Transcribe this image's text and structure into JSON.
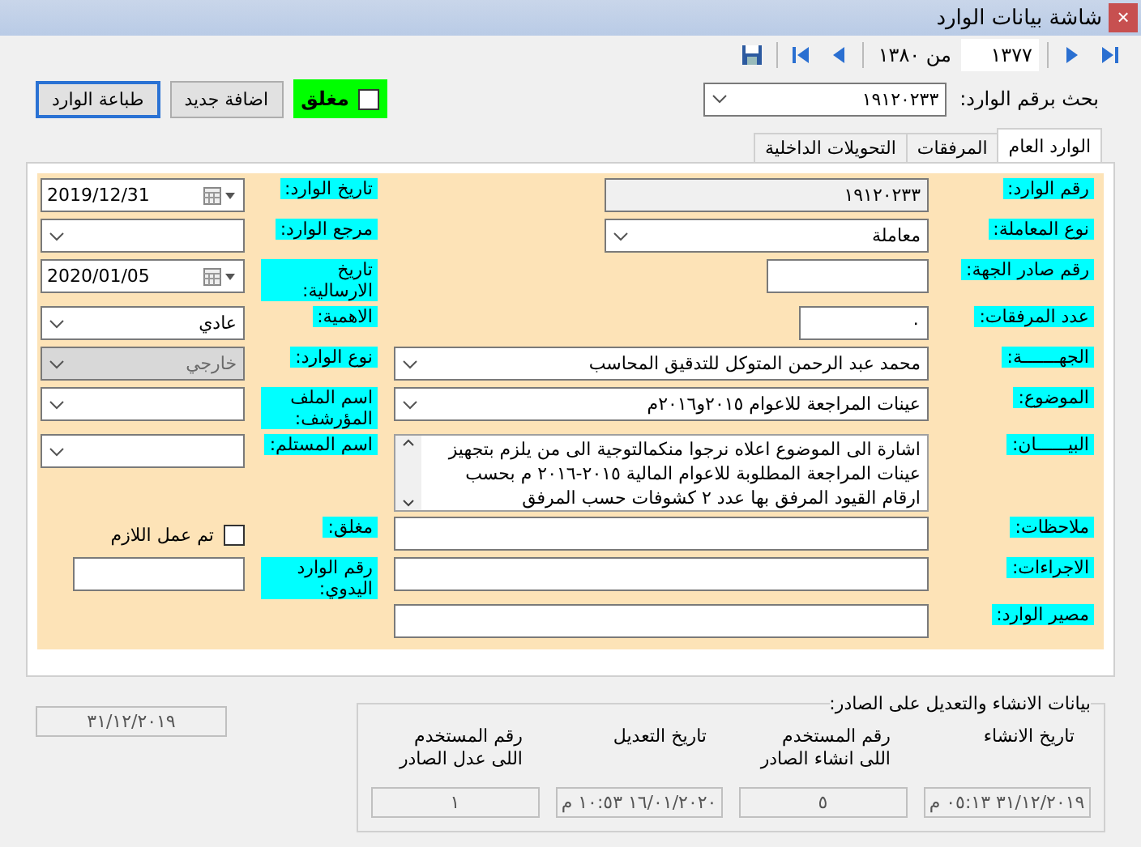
{
  "window": {
    "title": "شاشة بيانات الوارد",
    "close": "×"
  },
  "navigator": {
    "current": "١٣٧٧",
    "total": "من ١٣٨٠"
  },
  "search": {
    "label": "بحث برقم الوارد:",
    "value": "١٩١٢٠٢٣٣"
  },
  "closed_flag": {
    "label": "مغلق",
    "checked": false
  },
  "buttons": [
    "اضافة جديد",
    "طباعة الوارد"
  ],
  "tabs": [
    {
      "label": "الوارد العام",
      "selected": true
    },
    {
      "label": "المرفقات",
      "selected": false
    },
    {
      "label": "التحويلات الداخلية",
      "selected": false
    }
  ],
  "form": {
    "right": [
      {
        "kind": "text",
        "label": "رقم الوارد:",
        "value": "١٩١٢٠٢٣٣",
        "disabled": true
      },
      {
        "kind": "combo",
        "label": "نوع المعاملة:",
        "value": "معاملة",
        "disabled": false
      },
      {
        "kind": "text",
        "label": "رقم صادر الجهة:",
        "disabled": false
      },
      {
        "kind": "text",
        "label": "عدد المرفقات:",
        "value": "٠",
        "disabled": false
      },
      {
        "kind": "combo",
        "label": "الجهـــــــة:",
        "value": "محمد عبد الرحمن المتوكل للتدقيق المحاسب",
        "disabled": false
      },
      {
        "kind": "combo",
        "label": "الموضوع:",
        "value": "عينات المراجعة للاعوام ٢٠١٥و٢٠١٦م",
        "disabled": false
      },
      {
        "kind": "textarea",
        "label": "البيــــــان:",
        "value": "اشارة الى الموضوع اعلاه نرجوا منكمالتوجية الى من يلزم بتجهيز عينات المراجعة المطلوبة للاعوام المالية ٢٠١٥-٢٠١٦ م بحسب ارقام القيود المرفق بها عدد ٢ كشوفات حسب المرفق",
        "disabled": false
      },
      {
        "kind": "text",
        "label": "ملاحظات:",
        "disabled": false
      },
      {
        "kind": "text",
        "label": "الاجراءات:",
        "disabled": false
      },
      {
        "kind": "text",
        "label": "مصير الوارد:",
        "disabled": false
      }
    ],
    "left": [
      {
        "kind": "date",
        "label": "تاريخ الوارد:",
        "value": "2019/12/31",
        "disabled": false
      },
      {
        "kind": "combo",
        "label": "مرجع الوارد:",
        "disabled": false
      },
      {
        "kind": "date",
        "label": "تاريخ الارسالية:",
        "value": "2020/01/05",
        "disabled": false
      },
      {
        "kind": "combo",
        "label": "الاهمية:",
        "value": "عادي",
        "disabled": false
      },
      {
        "kind": "combo",
        "label": "نوع الوارد:",
        "value": "خارجي",
        "disabled": true
      },
      {
        "kind": "combo",
        "label": "اسم الملف المؤرشف:",
        "disabled": false
      },
      {
        "kind": "combo",
        "label": "اسم المستلم:",
        "disabled": false
      },
      {
        "kind": "checkbox",
        "label": "مغلق:",
        "text": "تم عمل اللازم",
        "checked": false
      },
      {
        "kind": "text",
        "label": "رقم الوارد اليدوي:",
        "disabled": false
      }
    ]
  },
  "footer_date": "٣١/١٢/٢٠١٩",
  "audit": {
    "title": "بيانات الانشاء والتعديل على الصادر:",
    "columns": [
      {
        "header": "تاريخ الانشاء",
        "value": "٣١/١٢/٢٠١٩ ٠٥:١٣ م"
      },
      {
        "header": "رقم المستخدم اللى انشاء الصادر",
        "value": "٥"
      },
      {
        "header": "تاريخ التعديل",
        "value": "١٦/٠١/٢٠٢٠ ١٠:٥٣ م"
      },
      {
        "header": "رقم المستخدم اللى عدل الصادر",
        "value": "١"
      }
    ]
  }
}
